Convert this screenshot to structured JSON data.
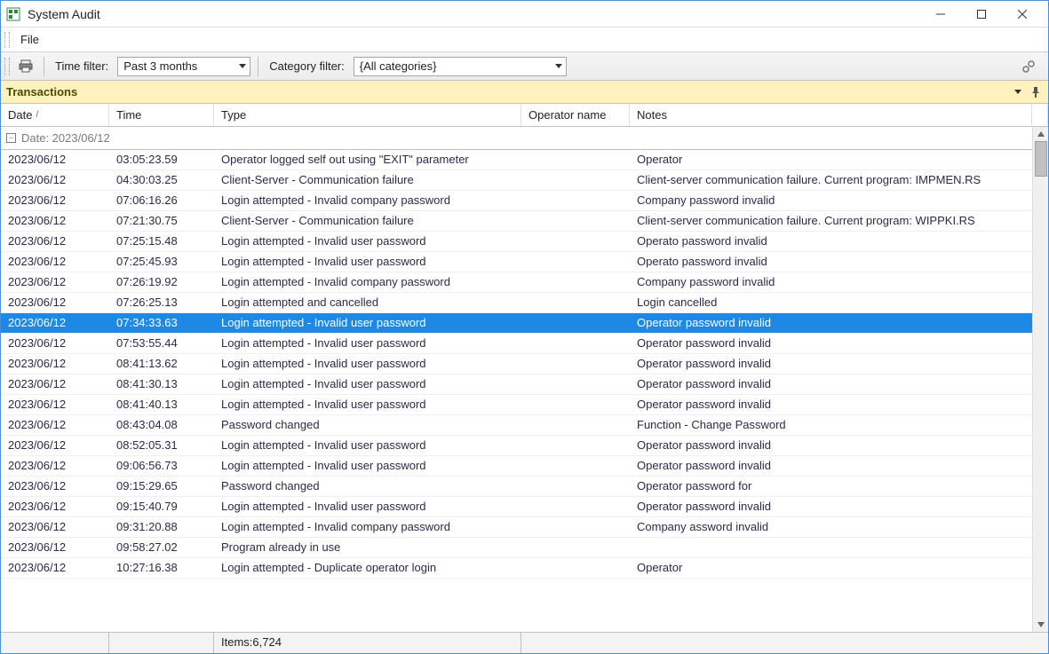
{
  "window": {
    "title": "System Audit"
  },
  "menu": {
    "file": "File"
  },
  "toolbar": {
    "time_filter_label": "Time filter:",
    "time_filter_value": "Past 3 months",
    "category_filter_label": "Category filter:",
    "category_filter_value": "{All categories}"
  },
  "panel": {
    "title": "Transactions"
  },
  "columns": {
    "date": "Date",
    "time": "Time",
    "type": "Type",
    "operator": "Operator name",
    "notes": "Notes"
  },
  "group": {
    "label": "Date: 2023/06/12"
  },
  "rows": [
    {
      "date": "2023/06/12",
      "time": "03:05:23.59",
      "type": "Operator logged self out using \"EXIT\" parameter",
      "op": "",
      "notes": "Operator",
      "sel": false
    },
    {
      "date": "2023/06/12",
      "time": "04:30:03.25",
      "type": "Client-Server - Communication failure",
      "op": "",
      "notes": "Client-server communication failure. Current program: IMPMEN.RS",
      "sel": false
    },
    {
      "date": "2023/06/12",
      "time": "07:06:16.26",
      "type": "Login attempted - Invalid company password",
      "op": "",
      "notes": "Company     password invalid",
      "sel": false
    },
    {
      "date": "2023/06/12",
      "time": "07:21:30.75",
      "type": "Client-Server - Communication failure",
      "op": "",
      "notes": "Client-server communication failure. Current program: WIPPKI.RS",
      "sel": false
    },
    {
      "date": "2023/06/12",
      "time": "07:25:15.48",
      "type": "Login attempted - Invalid user password",
      "op": "",
      "notes": "Operato          password invalid",
      "sel": false
    },
    {
      "date": "2023/06/12",
      "time": "07:25:45.93",
      "type": "Login attempted - Invalid user password",
      "op": "",
      "notes": "Operato          password invalid",
      "sel": false
    },
    {
      "date": "2023/06/12",
      "time": "07:26:19.92",
      "type": "Login attempted - Invalid company password",
      "op": "",
      "notes": "Company     password invalid",
      "sel": false
    },
    {
      "date": "2023/06/12",
      "time": "07:26:25.13",
      "type": "Login attempted and cancelled",
      "op": "",
      "notes": "Login cancelled",
      "sel": false
    },
    {
      "date": "2023/06/12",
      "time": "07:34:33.63",
      "type": "Login attempted - Invalid user password",
      "op": "",
      "notes": "Operator          password invalid",
      "sel": true
    },
    {
      "date": "2023/06/12",
      "time": "07:53:55.44",
      "type": "Login attempted - Invalid user password",
      "op": "",
      "notes": "Operator          password invalid",
      "sel": false
    },
    {
      "date": "2023/06/12",
      "time": "08:41:13.62",
      "type": "Login attempted - Invalid user password",
      "op": "",
      "notes": "Operator      password invalid",
      "sel": false
    },
    {
      "date": "2023/06/12",
      "time": "08:41:30.13",
      "type": "Login attempted - Invalid user password",
      "op": "",
      "notes": "Operator      password invalid",
      "sel": false
    },
    {
      "date": "2023/06/12",
      "time": "08:41:40.13",
      "type": "Login attempted - Invalid user password",
      "op": "",
      "notes": "Operator      password invalid",
      "sel": false
    },
    {
      "date": "2023/06/12",
      "time": "08:43:04.08",
      "type": "Password changed",
      "op": "",
      "notes": "Function - Change Password",
      "sel": false
    },
    {
      "date": "2023/06/12",
      "time": "08:52:05.31",
      "type": "Login attempted - Invalid user password",
      "op": "",
      "notes": "Operator        password invalid",
      "sel": false
    },
    {
      "date": "2023/06/12",
      "time": "09:06:56.73",
      "type": "Login attempted - Invalid user password",
      "op": "",
      "notes": "Operator        password invalid",
      "sel": false
    },
    {
      "date": "2023/06/12",
      "time": "09:15:29.65",
      "type": "Password changed",
      "op": "",
      "notes": "Operator password for",
      "sel": false
    },
    {
      "date": "2023/06/12",
      "time": "09:15:40.79",
      "type": "Login attempted - Invalid user password",
      "op": "",
      "notes": "Operator        password invalid",
      "sel": false
    },
    {
      "date": "2023/06/12",
      "time": "09:31:20.88",
      "type": "Login attempted - Invalid company password",
      "op": "",
      "notes": "Company      assword invalid",
      "sel": false
    },
    {
      "date": "2023/06/12",
      "time": "09:58:27.02",
      "type": "Program already in use",
      "op": "",
      "notes": "",
      "sel": false
    },
    {
      "date": "2023/06/12",
      "time": "10:27:16.38",
      "type": "Login attempted - Duplicate operator login",
      "op": "",
      "notes": "Operator",
      "sel": false
    }
  ],
  "status": {
    "items": "Items:6,724"
  }
}
